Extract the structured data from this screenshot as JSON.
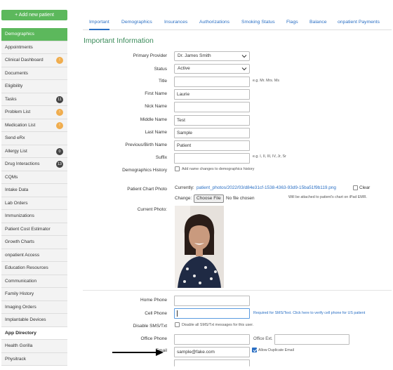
{
  "sidebar": {
    "add_button": "+ Add new patient",
    "items": [
      {
        "label": "Demographics",
        "active": true
      },
      {
        "label": "Appointments"
      },
      {
        "label": "Clinical Dashboard",
        "badge": "!",
        "badge_type": "warn"
      },
      {
        "label": "Documents"
      },
      {
        "label": "Eligibility"
      },
      {
        "label": "Tasks",
        "badge": "11",
        "badge_type": "dark"
      },
      {
        "label": "Problem List",
        "badge": "!",
        "badge_type": "warn"
      },
      {
        "label": "Medication List",
        "badge": "!",
        "badge_type": "warn"
      },
      {
        "label": "Send eRx"
      },
      {
        "label": "Allergy List",
        "badge": "0",
        "badge_type": "dark"
      },
      {
        "label": "Drug Interactions",
        "badge": "13",
        "badge_type": "dark"
      },
      {
        "label": "CQMs"
      },
      {
        "label": "Intake Data"
      },
      {
        "label": "Lab Orders"
      },
      {
        "label": "Immunizations"
      },
      {
        "label": "Patient Cost Estimator"
      },
      {
        "label": "Growth Charts"
      },
      {
        "label": "onpatient Access"
      },
      {
        "label": "Education Resources"
      },
      {
        "label": "Communication"
      },
      {
        "label": "Family History"
      },
      {
        "label": "Imaging Orders"
      },
      {
        "label": "Implantable Devices"
      },
      {
        "label": "App Directory",
        "header": true
      },
      {
        "label": "Health Gorilla"
      },
      {
        "label": "Physitrack"
      }
    ]
  },
  "tabs": [
    "Important",
    "Demographics",
    "Insurances",
    "Authorizations",
    "Smoking Status",
    "Flags",
    "Balance",
    "onpatient Payments"
  ],
  "section_title": "Important Information",
  "form": {
    "primary_provider": {
      "label": "Primary Provider",
      "value": "Dr. James Smith"
    },
    "status": {
      "label": "Status",
      "value": "Active"
    },
    "title": {
      "label": "Title",
      "value": "",
      "hint": "e.g. Mr. Mrs. Ms"
    },
    "first_name": {
      "label": "First Name",
      "value": "Laurie"
    },
    "nick_name": {
      "label": "Nick Name",
      "value": ""
    },
    "middle_name": {
      "label": "Middle Name",
      "value": "Test"
    },
    "last_name": {
      "label": "Last Name",
      "value": "Sample"
    },
    "previous_name": {
      "label": "Previous/Birth Name",
      "value": "Patient"
    },
    "suffix": {
      "label": "Suffix",
      "value": "",
      "hint": "e.g. I, II, III, IV, Jr, Sr"
    },
    "demographics_history": {
      "label": "Demographics History",
      "checkbox_label": "Add name changes to demographics history"
    },
    "chart_photo": {
      "label": "Patient Chart Photo",
      "currently_label": "Currently:",
      "current_file": "patient_photos/2022/03/d84e31cf-1538-4363-93d9-15ba51f9b119.png",
      "clear_label": "Clear",
      "change_label": "Change:",
      "choose_file": "Choose File",
      "no_file": "No file chosen",
      "ipad_hint": "Will be attached to patient's chart on iPad EMR."
    },
    "current_photo": {
      "label": "Current Photo:"
    },
    "home_phone": {
      "label": "Home Phone",
      "value": ""
    },
    "cell_phone": {
      "label": "Cell Phone",
      "value": "",
      "hint": "Required for SMS/Text. Click here to verify cell phone for US patient"
    },
    "disable_sms": {
      "label": "Disable SMS/Txt",
      "checkbox_label": "Disable all SMS/Txt messages for this user."
    },
    "office_phone": {
      "label": "Office Phone",
      "value": ""
    },
    "office_ext": {
      "label": "Office Ext.",
      "value": ""
    },
    "email": {
      "label": "Email",
      "value": "sample@fake.com",
      "checkbox_label": "Allow Duplicate Email"
    }
  },
  "colors": {
    "accent_green": "#5cb85c",
    "link_blue": "#2a6fc4",
    "title_green": "#3b8b5a"
  }
}
